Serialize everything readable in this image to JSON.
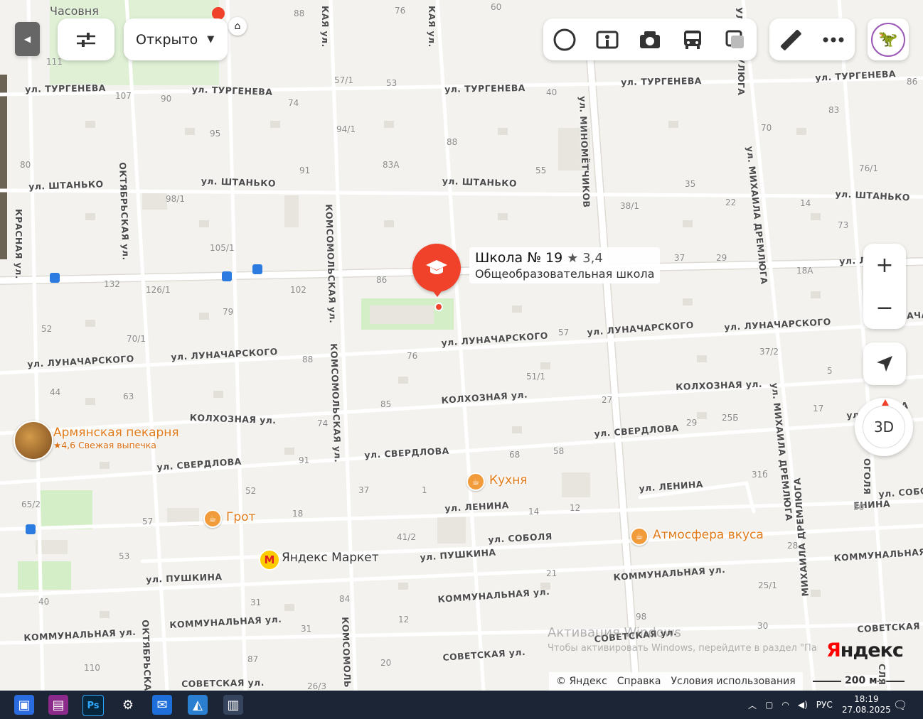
{
  "toolbar": {
    "filter_label": "Открыто",
    "filter_arrow": "▼",
    "collapse_icon": "chevron-left-icon",
    "layers": [
      "satellite-layer-icon",
      "panorama-icon",
      "photo-icon",
      "transit-icon",
      "traffic-icon"
    ],
    "ruler_icon": "ruler-icon",
    "more_icon": "more-icon",
    "avatar_icon": "dinosaur-avatar-icon"
  },
  "place_card": {
    "name": "Школа № 19",
    "rating": "★ 3,4",
    "type": "Общеобразовательная школа"
  },
  "pois": [
    {
      "name": "Армянская пекарня",
      "sub": "★4,6 Свежая выпечка"
    },
    {
      "name": "Кухня"
    },
    {
      "name": "Грот"
    },
    {
      "name": "Атмосфера вкуса"
    },
    {
      "name": "Яндекс Маркет"
    }
  ],
  "top_labels": {
    "chapel": "Часовня"
  },
  "streets": [
    "ул. ТУРГЕНЕВА",
    "ул. ТУРГЕНЕВА",
    "ул. ТУРГЕНЕВА",
    "ул. ТУРГЕНЕВА",
    "ул. ТУРГЕНЕВА",
    "ул. ШТАНЬКО",
    "ул. ШТАНЬКО",
    "ул. ШТАНЬКО",
    "ул. ШТАНЬКО",
    "ул. ЛУНАЧАРСКОГО",
    "ул. ЛУНАЧАРСКОГО",
    "ул. ЛУНАЧАРСКОГО",
    "ул. ЛУНАЧАРСКОГО",
    "ул. ЛУНАЧАРСКОГО",
    "КОЛХОЗНАЯ ул.",
    "КОЛХОЗНАЯ ул.",
    "КОЛХОЗНАЯ ул.",
    "ул. СВЕРДЛОВА",
    "ул. СВЕРДЛОВА",
    "ул. СВЕРДЛОВА",
    "ул. ЛЕНИНА",
    "ул. ЛЕНИНА",
    "ул. СОБОЛЯ",
    "ул. ПУШКИНА",
    "ул. ПУШКИНА",
    "КОММУНАЛЬНАЯ ул.",
    "КОММУНАЛЬНАЯ ул.",
    "КОММУНАЛЬНАЯ ул.",
    "КОММУНАЛЬНАЯ ул.",
    "КОММУНАЛЬНАЯ",
    "СОВЕТСКАЯ ул.",
    "СОВЕТСКАЯ ул.",
    "СОВЕТСКАЯ ул.",
    "СОВЕТСКАЯ",
    "ОКТЯБРЬСКАЯ ул.",
    "ОКТЯБРЬСКАЯ",
    "КОМСОМОЛЬСКАЯ ул.",
    "КОМСОМОЛЬСКАЯ ул.",
    "КОМСОМОЛЬ",
    "ул. МИНОМЁТЧИКОВ",
    "ул. МИХАИЛА ДРЕМЛЮГА",
    "ул. МИХАИЛА ДРЕМЛЮГА",
    "МИХАИЛА ДРЕМЛЮГА",
    "КРАСНАЯ ул.",
    "КАЯ ул.",
    "КАЯ ул.",
    "УЛЮГА",
    "ул. Л",
    "ул. СОБО",
    "ул. ЛУНАЧА",
    "ЕНИНА",
    "ОВА",
    "СЛЯ",
    "ОГОЛЯ",
    "УЛЮГА",
    "ул. КЛ",
    "ул. ОВА"
  ],
  "house_numbers": [
    "88",
    "76",
    "60",
    "111",
    "107",
    "90",
    "57/1",
    "53",
    "40",
    "86",
    "95",
    "94/1",
    "74",
    "88",
    "83",
    "70",
    "80",
    "91",
    "83А",
    "55",
    "76/1",
    "98/1",
    "35",
    "22",
    "14",
    "38/1",
    "73",
    "105/1",
    "37",
    "29",
    "18А",
    "132",
    "126/1",
    "102",
    "86",
    "79",
    "52",
    "70/1",
    "88",
    "76",
    "57",
    "37/2",
    "51/1",
    "5",
    "44",
    "63",
    "85",
    "27",
    "17",
    "29",
    "25Б",
    "74",
    "91",
    "68",
    "58",
    "52",
    "37",
    "1",
    "31б",
    "65/2",
    "57",
    "18",
    "14",
    "12",
    "50",
    "53",
    "41/2",
    "21",
    "28",
    "25/1",
    "40",
    "31",
    "84",
    "12",
    "98",
    "31",
    "30",
    "87",
    "20",
    "110",
    "26/3"
  ],
  "zoom": {
    "plus": "+",
    "minus": "−"
  },
  "compass_label": "3D",
  "logo": "Яндекс",
  "watermark": {
    "title": "Активация Windows",
    "text": "Чтобы активировать Windows, перейдите в раздел \"Пар"
  },
  "footer": {
    "copyright": "© Яндекс",
    "help": "Справка",
    "terms": "Условия использования",
    "scale": "200 м"
  },
  "taskbar": {
    "lang": "РУС",
    "time": "18:19",
    "date": "27.08.2025"
  },
  "colors": {
    "marker": "#f0422b",
    "poi": "#e07b1a",
    "accent": "#ffd33b"
  }
}
